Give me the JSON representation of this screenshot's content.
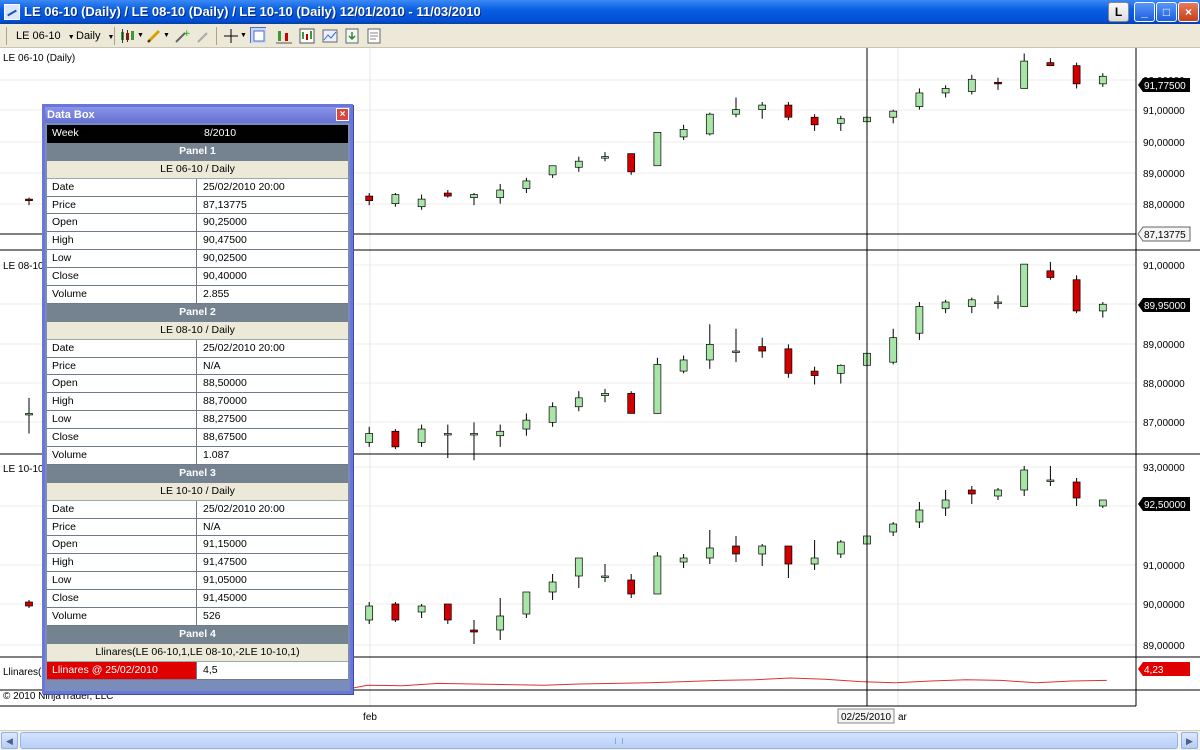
{
  "window": {
    "title": "LE 06-10 (Daily) / LE 08-10 (Daily) / LE 10-10 (Daily)  12/01/2010 - 11/03/2010",
    "buttons": {
      "link": "L",
      "minimize": "_",
      "maximize": "□",
      "close": "×"
    }
  },
  "toolbar": {
    "instrument": "LE 06-10",
    "interval": "Daily"
  },
  "panels": [
    {
      "label": "LE 06-10 (Daily)",
      "price_label": "91,77500",
      "crosshair_label": "87,13775",
      "ticks": [
        "92,00000",
        "91,00000",
        "90,00000",
        "89,00000",
        "88,00000"
      ]
    },
    {
      "label": "LE 08-10",
      "price_label": "89,95000",
      "ticks": [
        "91,00000",
        "90,00000",
        "89,00000",
        "88,00000",
        "87,00000"
      ]
    },
    {
      "label": "LE 10-10",
      "price_label": "92,50000",
      "ticks": [
        "93,00000",
        "92,00000",
        "91,00000",
        "90,00000",
        "89,00000"
      ]
    },
    {
      "label": "Llinares(",
      "price_label": "4,23"
    }
  ],
  "xaxis": {
    "labels": [
      "feb",
      "ar"
    ],
    "crosshair_date": "02/25/2010"
  },
  "copyright": "© 2010 NinjaTrader, LLC",
  "colors": {
    "up": "#a8e6a8",
    "down": "#d00000",
    "indicator": "#e03030",
    "accent": "#6b77d6"
  },
  "databox": {
    "title": "Data Box",
    "week_label": "Week",
    "week_value": "8/2010",
    "sections": [
      {
        "panel": "Panel 1",
        "instrument": "LE 06-10 / Daily",
        "rows": [
          [
            "Date",
            "25/02/2010 20:00"
          ],
          [
            "Price",
            "87,13775"
          ],
          [
            "Open",
            "90,25000"
          ],
          [
            "High",
            "90,47500"
          ],
          [
            "Low",
            "90,02500"
          ],
          [
            "Close",
            "90,40000"
          ],
          [
            "Volume",
            "2.855"
          ]
        ]
      },
      {
        "panel": "Panel 2",
        "instrument": "LE 08-10 / Daily",
        "rows": [
          [
            "Date",
            "25/02/2010 20:00"
          ],
          [
            "Price",
            "N/A"
          ],
          [
            "Open",
            "88,50000"
          ],
          [
            "High",
            "88,70000"
          ],
          [
            "Low",
            "88,27500"
          ],
          [
            "Close",
            "88,67500"
          ],
          [
            "Volume",
            "1.087"
          ]
        ]
      },
      {
        "panel": "Panel 3",
        "instrument": "LE 10-10 / Daily",
        "rows": [
          [
            "Date",
            "25/02/2010 20:00"
          ],
          [
            "Price",
            "N/A"
          ],
          [
            "Open",
            "91,15000"
          ],
          [
            "High",
            "91,47500"
          ],
          [
            "Low",
            "91,05000"
          ],
          [
            "Close",
            "91,45000"
          ],
          [
            "Volume",
            "526"
          ]
        ]
      },
      {
        "panel": "Panel 4",
        "instrument": "Llinares(LE  06-10,1,LE  08-10,-2LE  10-10,1)",
        "rows": [
          [
            "Llinares @ 25/02/2010",
            "4,5"
          ]
        ]
      }
    ]
  },
  "chart_data": [
    {
      "type": "candlestick",
      "name": "LE 06-10 (Daily)",
      "ylim": [
        86.6,
        92.6
      ],
      "candles": [
        [
          87.75,
          87.8,
          87.55,
          87.7
        ],
        [
          87.85,
          87.95,
          87.55,
          87.7
        ],
        [
          87.6,
          87.95,
          87.5,
          87.9
        ],
        [
          87.5,
          87.9,
          87.4,
          87.75
        ],
        [
          87.95,
          88.05,
          87.8,
          87.85
        ],
        [
          87.8,
          87.95,
          87.55,
          87.9
        ],
        [
          87.8,
          88.25,
          87.6,
          88.05
        ],
        [
          88.1,
          88.45,
          87.95,
          88.35
        ],
        [
          88.55,
          88.85,
          88.45,
          88.85
        ],
        [
          88.8,
          89.15,
          88.65,
          89.0
        ],
        [
          89.1,
          89.3,
          89.0,
          89.15
        ],
        [
          89.25,
          89.25,
          88.55,
          88.65
        ],
        [
          88.85,
          89.95,
          88.85,
          89.95
        ],
        [
          89.8,
          90.2,
          89.7,
          90.05
        ],
        [
          89.9,
          90.6,
          89.85,
          90.55
        ],
        [
          90.55,
          91.1,
          90.45,
          90.7
        ],
        [
          90.7,
          90.95,
          90.4,
          90.85
        ],
        [
          90.85,
          90.95,
          90.35,
          90.45
        ],
        [
          90.45,
          90.55,
          90.0,
          90.2
        ],
        [
          90.25,
          90.5,
          90.0,
          90.4
        ],
        [
          90.3,
          90.5,
          89.95,
          90.45
        ],
        [
          90.45,
          90.7,
          90.25,
          90.65
        ],
        [
          90.8,
          91.4,
          90.7,
          91.25
        ],
        [
          91.25,
          91.5,
          91.1,
          91.4
        ],
        [
          91.3,
          91.85,
          91.2,
          91.7
        ],
        [
          91.6,
          91.75,
          91.35,
          91.55
        ],
        [
          91.4,
          92.55,
          91.4,
          92.3
        ],
        [
          92.25,
          92.4,
          92.15,
          92.15
        ],
        [
          92.15,
          92.25,
          91.4,
          91.55
        ],
        [
          91.55,
          91.9,
          91.45,
          91.8
        ]
      ]
    },
    {
      "type": "candlestick",
      "name": "LE 08-10",
      "ylim": [
        86.6,
        91.2
      ],
      "candles": [
        [
          87.6,
          87.95,
          87.15,
          87.6
        ],
        [
          86.95,
          87.3,
          86.85,
          87.15
        ],
        [
          87.2,
          87.25,
          86.8,
          86.85
        ],
        [
          86.95,
          87.35,
          86.85,
          87.25
        ],
        [
          87.15,
          87.35,
          86.6,
          87.15
        ],
        [
          87.15,
          87.4,
          86.55,
          87.15
        ],
        [
          87.1,
          87.35,
          86.85,
          87.2
        ],
        [
          87.25,
          87.6,
          87.1,
          87.45
        ],
        [
          87.4,
          87.85,
          87.3,
          87.75
        ],
        [
          87.75,
          88.1,
          87.65,
          87.95
        ],
        [
          88.0,
          88.15,
          87.85,
          88.05
        ],
        [
          88.05,
          88.1,
          87.6,
          87.6
        ],
        [
          87.6,
          88.85,
          87.6,
          88.7
        ],
        [
          88.55,
          88.9,
          88.5,
          88.8
        ],
        [
          88.8,
          89.6,
          88.6,
          89.15
        ],
        [
          89.0,
          89.5,
          88.75,
          89.0
        ],
        [
          89.1,
          89.3,
          88.85,
          89.0
        ],
        [
          89.05,
          89.15,
          88.4,
          88.5
        ],
        [
          88.55,
          88.65,
          88.25,
          88.45
        ],
        [
          88.5,
          88.7,
          88.27,
          88.68
        ],
        [
          88.68,
          89.0,
          88.5,
          88.95
        ],
        [
          88.75,
          89.5,
          88.7,
          89.3
        ],
        [
          89.4,
          90.1,
          89.25,
          90.0
        ],
        [
          89.95,
          90.15,
          89.85,
          90.1
        ],
        [
          90.0,
          90.2,
          89.85,
          90.15
        ],
        [
          90.1,
          90.25,
          89.95,
          90.1
        ],
        [
          90.0,
          90.95,
          90.0,
          90.95
        ],
        [
          90.8,
          91.0,
          90.6,
          90.65
        ],
        [
          90.6,
          90.7,
          89.85,
          89.9
        ],
        [
          89.9,
          90.1,
          89.75,
          90.05
        ]
      ]
    },
    {
      "type": "candlestick",
      "name": "LE 10-10",
      "ylim": [
        88.6,
        93.6
      ],
      "candles": [
        [
          89.95,
          90.0,
          89.8,
          89.85
        ],
        [
          89.5,
          89.95,
          89.4,
          89.85
        ],
        [
          89.9,
          89.95,
          89.45,
          89.5
        ],
        [
          89.7,
          89.9,
          89.55,
          89.85
        ],
        [
          89.9,
          89.9,
          89.4,
          89.5
        ],
        [
          89.25,
          89.5,
          88.9,
          89.2
        ],
        [
          89.25,
          90.05,
          89.0,
          89.6
        ],
        [
          89.65,
          90.2,
          89.55,
          90.2
        ],
        [
          90.2,
          90.65,
          90.0,
          90.45
        ],
        [
          90.6,
          91.05,
          90.3,
          91.05
        ],
        [
          90.6,
          90.9,
          90.45,
          90.6
        ],
        [
          90.5,
          90.65,
          90.05,
          90.15
        ],
        [
          90.15,
          91.2,
          90.15,
          91.1
        ],
        [
          90.95,
          91.15,
          90.8,
          91.05
        ],
        [
          91.05,
          91.75,
          90.9,
          91.3
        ],
        [
          91.35,
          91.6,
          90.95,
          91.15
        ],
        [
          91.15,
          91.4,
          90.85,
          91.35
        ],
        [
          91.35,
          91.35,
          90.55,
          90.9
        ],
        [
          90.9,
          91.5,
          90.75,
          91.05
        ],
        [
          91.15,
          91.5,
          91.05,
          91.45
        ],
        [
          91.4,
          91.95,
          91.2,
          91.6
        ],
        [
          91.7,
          91.95,
          91.6,
          91.9
        ],
        [
          91.95,
          92.45,
          91.8,
          92.25
        ],
        [
          92.3,
          92.75,
          92.1,
          92.5
        ],
        [
          92.75,
          92.85,
          92.4,
          92.65
        ],
        [
          92.6,
          92.8,
          92.5,
          92.75
        ],
        [
          92.75,
          93.35,
          92.6,
          93.25
        ],
        [
          93.0,
          93.35,
          92.85,
          93.0
        ],
        [
          92.95,
          93.05,
          92.35,
          92.55
        ],
        [
          92.35,
          92.5,
          92.3,
          92.5
        ]
      ]
    },
    {
      "type": "line",
      "name": "Llinares",
      "ylim": [
        2.5,
        5.5
      ],
      "values": [
        3.3,
        3.25,
        3.35,
        3.9,
        3.85,
        4.05,
        4.0,
        3.95,
        3.9,
        4.0,
        4.05,
        4.1,
        4.2,
        4.3,
        4.35,
        4.5,
        4.4,
        4.2,
        4.1,
        4.25,
        4.35,
        4.3,
        4.1,
        4.25,
        4.3
      ]
    }
  ]
}
